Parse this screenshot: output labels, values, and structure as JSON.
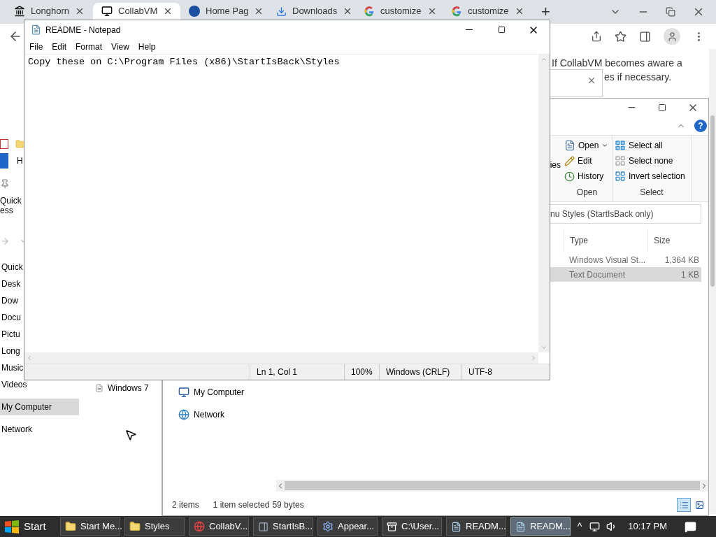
{
  "browser": {
    "tabs": [
      {
        "title": "Longhorn",
        "kind": "landmark",
        "selected": false
      },
      {
        "title": "CollabVM",
        "kind": "computer",
        "selected": true
      },
      {
        "title": "Home Pag",
        "kind": "badge",
        "selected": false
      },
      {
        "title": "Downloads",
        "kind": "download",
        "selected": false
      },
      {
        "title": "customize",
        "kind": "search",
        "selected": false
      },
      {
        "title": "customize",
        "kind": "search",
        "selected": false
      }
    ],
    "new_tab": "+",
    "page_lines": [
      "If CollabVM becomes aware a",
      "es if necessary."
    ]
  },
  "explorer_back": {
    "tab_letter": "H",
    "ribbon_label_lines": [
      "Quick",
      "ess"
    ],
    "nav_items": [
      {
        "label": "Quick",
        "selected": false
      },
      {
        "label": "Desk",
        "selected": false
      },
      {
        "label": "Dow",
        "selected": false
      },
      {
        "label": "Docu",
        "selected": false
      },
      {
        "label": "Pictu",
        "selected": false
      },
      {
        "label": "Long",
        "selected": false
      },
      {
        "label": "Music",
        "selected": false
      },
      {
        "label": "Videos",
        "selected": false
      },
      {
        "label": "My Computer",
        "selected": true
      },
      {
        "label": "Network",
        "selected": false
      }
    ],
    "content_item": "Windows 7"
  },
  "explorer_front": {
    "ribbon_cut_label": "ies",
    "groups": [
      {
        "label": "Open",
        "items": [
          {
            "label": "Open",
            "kind": "open",
            "dropdown": true
          },
          {
            "label": "Edit",
            "kind": "edit",
            "dropdown": false
          },
          {
            "label": "History",
            "kind": "history",
            "dropdown": false
          }
        ]
      },
      {
        "label": "Select",
        "items": [
          {
            "label": "Select all",
            "kind": "all",
            "dropdown": false
          },
          {
            "label": "Select none",
            "kind": "none",
            "dropdown": false
          },
          {
            "label": "Invert selection",
            "kind": "invert",
            "dropdown": false
          }
        ]
      }
    ],
    "help": "?",
    "address": "nu Styles (StartIsBack only)",
    "columns": [
      "Type",
      "Size"
    ],
    "rows": [
      {
        "type": "Windows Visual St...",
        "size": "1,364 KB",
        "selected": false
      },
      {
        "type": "Text Document",
        "size": "1 KB",
        "selected": true
      }
    ],
    "nav_items": [
      {
        "label": "My Computer",
        "kind": "computer"
      },
      {
        "label": "Network",
        "kind": "network"
      }
    ],
    "status": {
      "count": "2 items",
      "selection": "1 item selected",
      "size": "59 bytes"
    },
    "views": [
      {
        "kind": "details",
        "selected": true
      },
      {
        "kind": "large",
        "selected": false
      }
    ]
  },
  "notepad": {
    "title": "README - Notepad",
    "menu": [
      "File",
      "Edit",
      "Format",
      "View",
      "Help"
    ],
    "text": "Copy these on C:\\Program Files (x86)\\StartIsBack\\Styles",
    "status": [
      "Ln 1, Col 1",
      "100%",
      "Windows (CRLF)",
      "UTF-8"
    ]
  },
  "taskbar": {
    "start": "Start",
    "items": [
      {
        "label": "Start Me...",
        "kind": "folder",
        "selected": false
      },
      {
        "label": "Styles",
        "kind": "folder",
        "selected": false
      },
      {
        "label": "CollabV...",
        "kind": "browser",
        "selected": false
      },
      {
        "label": "StartIsB...",
        "kind": "app",
        "selected": false
      },
      {
        "label": "Appear...",
        "kind": "settings",
        "selected": false
      },
      {
        "label": "C:\\User...",
        "kind": "archive",
        "selected": false
      },
      {
        "label": "READM...",
        "kind": "notepad",
        "selected": false
      },
      {
        "label": "READM...",
        "kind": "notepad",
        "selected": true
      }
    ],
    "tray_caret": "^",
    "time": "10:17 PM"
  }
}
